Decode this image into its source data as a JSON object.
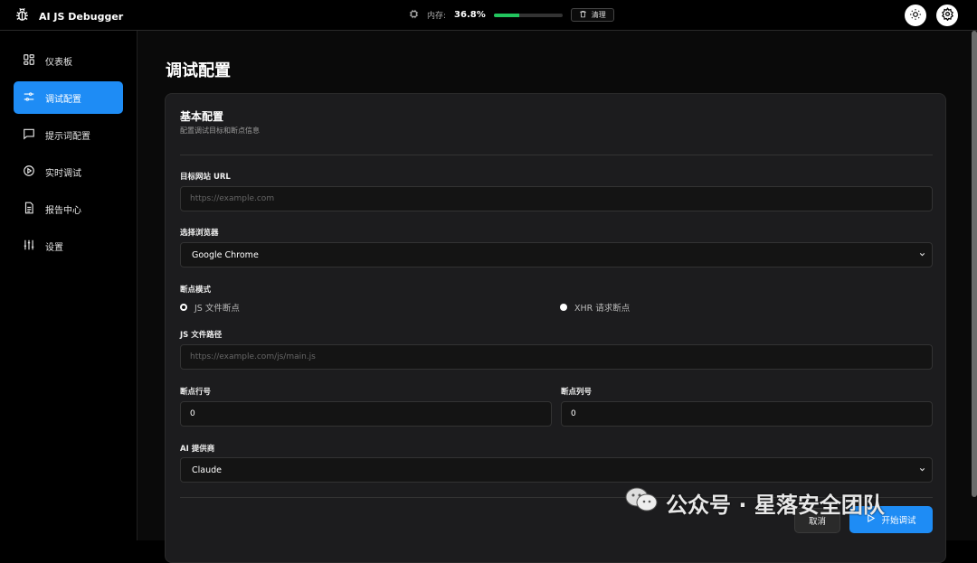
{
  "app": {
    "title": "AI JS Debugger"
  },
  "topbar": {
    "memory_label": "内存:",
    "memory_value": "36.8%",
    "memory_fraction": 0.368,
    "clear_label": "清理",
    "icons": {
      "brand": "bug-icon",
      "memory": "chip-icon",
      "clear": "trash-icon",
      "theme": "sun-icon",
      "settings": "gear-icon"
    }
  },
  "sidebar": {
    "items": [
      {
        "label": "仪表板",
        "icon": "dashboard-grid-icon",
        "active": false
      },
      {
        "label": "调试配置",
        "icon": "sliders-icon",
        "active": true
      },
      {
        "label": "提示词配置",
        "icon": "message-square-icon",
        "active": false
      },
      {
        "label": "实时调试",
        "icon": "play-circle-icon",
        "active": false
      },
      {
        "label": "报告中心",
        "icon": "file-text-icon",
        "active": false
      },
      {
        "label": "设置",
        "icon": "settings-sliders-icon",
        "active": false
      }
    ]
  },
  "main": {
    "page_title": "调试配置",
    "card": {
      "title": "基本配置",
      "subtitle": "配置调试目标和断点信息",
      "url_label": "目标网站 URL",
      "url_placeholder": "https://example.com",
      "browser_label": "选择浏览器",
      "browser_value": "Google Chrome",
      "mode_label": "断点模式",
      "mode_js": "JS 文件断点",
      "mode_xhr": "XHR 请求断点",
      "js_path_label": "JS 文件路径",
      "js_path_placeholder": "https://example.com/js/main.js",
      "line_label": "断点行号",
      "line_value": "0",
      "col_label": "断点列号",
      "col_value": "0",
      "ai_label": "AI 提供商",
      "ai_value": "Claude",
      "cancel_label": "取消",
      "start_label": "开始调试"
    }
  },
  "watermark": {
    "text": "公众号 · 星落安全团队"
  },
  "colors": {
    "accent": "#1e8cf5",
    "memory_bar": "#22c55e"
  }
}
